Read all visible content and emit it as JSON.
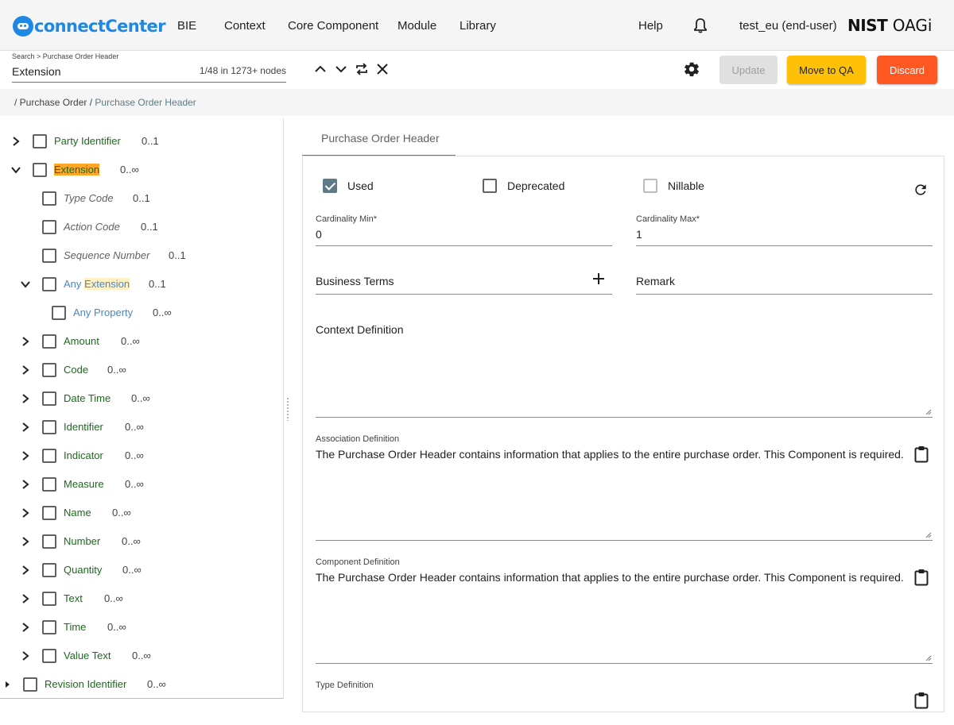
{
  "app": {
    "logo_text": "connectCenter",
    "brand_right": "NIST OAGi",
    "brand_nist": "NIST",
    "brand_oagi": "OAGi"
  },
  "nav": {
    "items": [
      "BIE",
      "Context",
      "Core Component",
      "Module",
      "Library"
    ],
    "help": "Help",
    "user": "test_eu (end-user)"
  },
  "search": {
    "label": "Search > Purchase Order Header",
    "value": "Extension",
    "count": "1/48 in 1273+ nodes"
  },
  "toolbar": {
    "update": "Update",
    "move_to_qa": "Move to QA",
    "discard": "Discard"
  },
  "breadcrumb": {
    "prefix": "/ Purchase Order /",
    "active": "Purchase Order Header"
  },
  "tree": {
    "nodes": [
      {
        "label": "Party Identifier",
        "card": "0..1"
      },
      {
        "label": "Extension",
        "card": "0..∞"
      },
      {
        "label": "Type Code",
        "card": "0..1"
      },
      {
        "label": "Action Code",
        "card": "0..1"
      },
      {
        "label": "Sequence Number",
        "card": "0..1"
      },
      {
        "label_prefix": "Any",
        "label_hl": "Extension",
        "card": "0..1"
      },
      {
        "label": "Any Property",
        "card": "0..∞"
      },
      {
        "label": "Amount",
        "card": "0..∞"
      },
      {
        "label": "Code",
        "card": "0..∞"
      },
      {
        "label": "Date Time",
        "card": "0..∞"
      },
      {
        "label": "Identifier",
        "card": "0..∞"
      },
      {
        "label": "Indicator",
        "card": "0..∞"
      },
      {
        "label": "Measure",
        "card": "0..∞"
      },
      {
        "label": "Name",
        "card": "0..∞"
      },
      {
        "label": "Number",
        "card": "0..∞"
      },
      {
        "label": "Quantity",
        "card": "0..∞"
      },
      {
        "label": "Text",
        "card": "0..∞"
      },
      {
        "label": "Time",
        "card": "0..∞"
      },
      {
        "label": "Value Text",
        "card": "0..∞"
      },
      {
        "label": "Revision Identifier",
        "card": "0..∞"
      }
    ]
  },
  "detail": {
    "tab": "Purchase Order Header",
    "used_label": "Used",
    "deprecated_label": "Deprecated",
    "nillable_label": "Nillable",
    "card_min_label": "Cardinality Min*",
    "card_min_value": "0",
    "card_max_label": "Cardinality Max*",
    "card_max_value": "1",
    "business_terms_label": "Business Terms",
    "remark_label": "Remark",
    "context_def_label": "Context Definition",
    "assoc_def_label": "Association Definition",
    "assoc_def_text": "The Purchase Order Header contains information that applies to the entire purchase order.  This Component is required.",
    "comp_def_label": "Component Definition",
    "comp_def_text": "The Purchase Order Header contains information that applies to the entire purchase order.  This Component is required.",
    "type_def_label": "Type Definition"
  },
  "icons": [
    "logo-icon",
    "bell-icon",
    "chevron-up-icon",
    "chevron-down-icon",
    "swap-icon",
    "close-icon",
    "gear-icon",
    "refresh-icon",
    "plus-icon",
    "clipboard-icon"
  ],
  "colors": {
    "accent": "#5d7a86",
    "move_to_qa": "#ffc107",
    "discard": "#ff5722",
    "node_green": "#1b6b1b",
    "node_blue": "#4a86c5",
    "logo_blue": "#1e88e5"
  }
}
